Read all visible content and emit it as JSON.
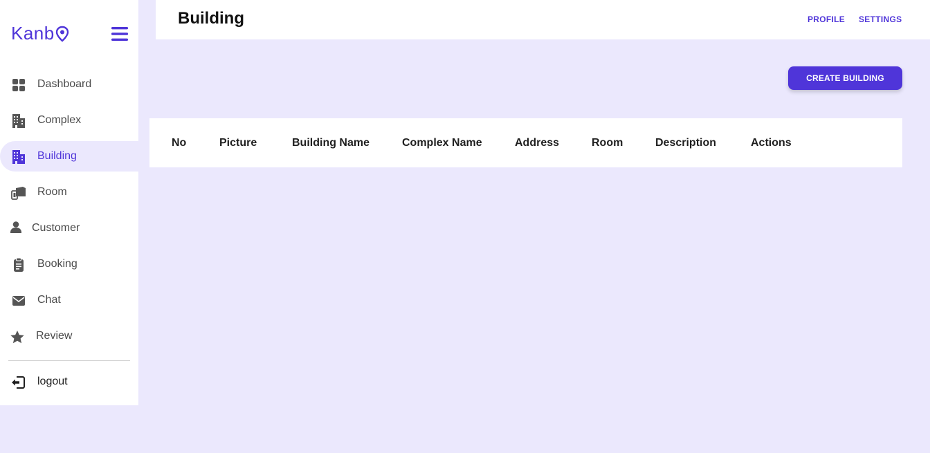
{
  "brand": {
    "name": "Kanb",
    "pin_icon": "location-pin-icon",
    "color": "#4f35d9"
  },
  "sidebar": {
    "items": [
      {
        "label": "Dashboard",
        "icon": "dashboard-grid-icon"
      },
      {
        "label": "Complex",
        "icon": "office-building-icon"
      },
      {
        "label": "Building",
        "icon": "building-icon",
        "active": true
      },
      {
        "label": "Room",
        "icon": "room-door-icon"
      },
      {
        "label": "Customer",
        "icon": "user-icon"
      },
      {
        "label": "Booking",
        "icon": "clipboard-icon"
      },
      {
        "label": "Chat",
        "icon": "envelope-icon"
      },
      {
        "label": "Review",
        "icon": "star-icon"
      }
    ],
    "logout": {
      "label": "logout",
      "icon": "sign-out-icon"
    }
  },
  "header": {
    "title": "Building",
    "links": {
      "profile": "PROFILE",
      "settings": "SETTINGS"
    }
  },
  "main": {
    "create_button": "CREATE BUILDING",
    "table": {
      "columns": [
        "No",
        "Picture",
        "Building Name",
        "Complex Name",
        "Address",
        "Room",
        "Description",
        "Actions"
      ],
      "rows": []
    }
  },
  "colors": {
    "accent": "#4f35d9",
    "background": "#ebe8fd",
    "icon_gray": "#555555"
  }
}
